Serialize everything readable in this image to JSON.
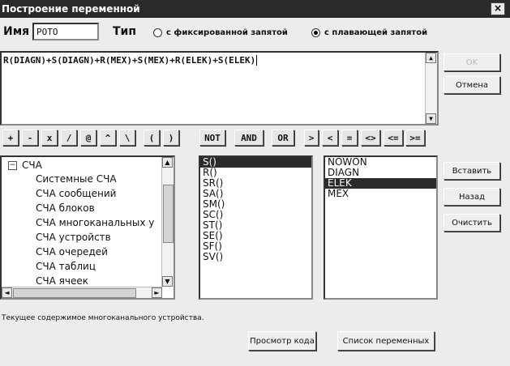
{
  "window": {
    "title": "Построение переменной",
    "close_glyph": "×"
  },
  "name_field": {
    "label": "Имя",
    "value": "POTO"
  },
  "type_field": {
    "label": "Тип"
  },
  "radio_fixed": {
    "label": "с фиксированной запятой",
    "selected": false
  },
  "radio_float": {
    "label": "с плавающей запятой",
    "selected": true
  },
  "expression": "R(DIAGN)+S(DIAGN)+R(MEX)+S(MEX)+R(ELEK)+S(ELEK)",
  "buttons": {
    "ok": "OK",
    "cancel": "Отмена",
    "insert": "Вставить",
    "back": "Назад",
    "clear": "Очистить",
    "view_code": "Просмотр кода",
    "var_list": "Список переменных"
  },
  "operators": [
    "+",
    "-",
    "x",
    "/",
    "@",
    "^",
    "\\",
    "(",
    ")"
  ],
  "logic_ops": [
    "NOT",
    "AND",
    "OR"
  ],
  "compare_ops": [
    ">",
    "<",
    "=",
    "<>",
    "<=",
    ">="
  ],
  "tree": {
    "root": "СЧА",
    "items": [
      "Системные СЧА",
      "СЧА сообщений",
      "СЧА блоков",
      "СЧА многоканальных у",
      "СЧА устройств",
      "СЧА очередей",
      "СЧА таблиц",
      "СЧА ячеек"
    ]
  },
  "functions": [
    "S()",
    "R()",
    "SR()",
    "SA()",
    "SM()",
    "SC()",
    "ST()",
    "SE()",
    "SF()",
    "SV()"
  ],
  "devices": [
    "NOWON",
    "DIAGN",
    "ELEK",
    "MEX"
  ],
  "status": "Текущее содержимое многоканального устройства.",
  "icons": {
    "scroll_up": "▲",
    "scroll_down": "▼",
    "scroll_left": "◄",
    "scroll_right": "►",
    "tree_collapse": "−"
  }
}
